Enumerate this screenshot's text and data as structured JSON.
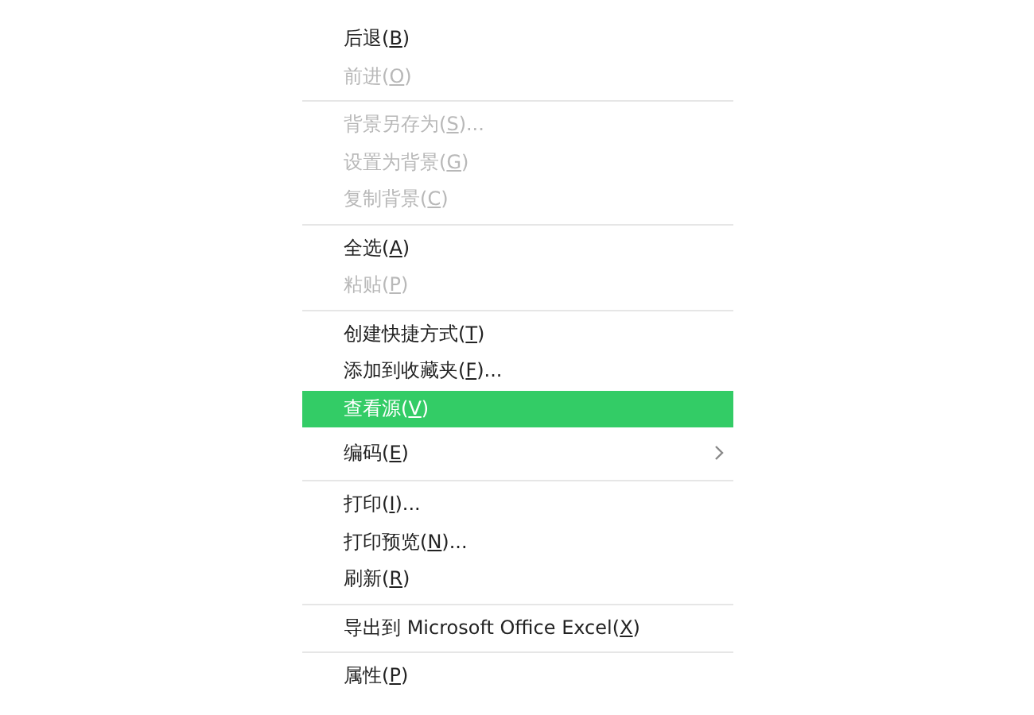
{
  "menu": {
    "groups": [
      {
        "items": [
          {
            "label": "后退(",
            "key": "B",
            "tail": ")",
            "disabled": false,
            "selected": false,
            "submenu": false
          },
          {
            "label": "前进(",
            "key": "O",
            "tail": ")",
            "disabled": true,
            "selected": false,
            "submenu": false
          }
        ]
      },
      {
        "items": [
          {
            "label": "背景另存为(",
            "key": "S",
            "tail": ")...",
            "disabled": true,
            "selected": false,
            "submenu": false
          },
          {
            "label": "设置为背景(",
            "key": "G",
            "tail": ")",
            "disabled": true,
            "selected": false,
            "submenu": false
          },
          {
            "label": "复制背景(",
            "key": "C",
            "tail": ")",
            "disabled": true,
            "selected": false,
            "submenu": false
          }
        ]
      },
      {
        "items": [
          {
            "label": "全选(",
            "key": "A",
            "tail": ")",
            "disabled": false,
            "selected": false,
            "submenu": false
          },
          {
            "label": "粘贴(",
            "key": "P",
            "tail": ")",
            "disabled": true,
            "selected": false,
            "submenu": false
          }
        ]
      },
      {
        "items": [
          {
            "label": "创建快捷方式(",
            "key": "T",
            "tail": ")",
            "disabled": false,
            "selected": false,
            "submenu": false
          },
          {
            "label": "添加到收藏夹(",
            "key": "F",
            "tail": ")...",
            "disabled": false,
            "selected": false,
            "submenu": false
          },
          {
            "label": "查看源(",
            "key": "V",
            "tail": ")",
            "disabled": false,
            "selected": true,
            "submenu": false
          },
          {
            "label": "编码(",
            "key": "E",
            "tail": ")",
            "disabled": false,
            "selected": false,
            "submenu": true
          }
        ]
      },
      {
        "items": [
          {
            "label": "打印(",
            "key": "I",
            "tail": ")...",
            "disabled": false,
            "selected": false,
            "submenu": false
          },
          {
            "label": "打印预览(",
            "key": "N",
            "tail": ")...",
            "disabled": false,
            "selected": false,
            "submenu": false
          },
          {
            "label": "刷新(",
            "key": "R",
            "tail": ")",
            "disabled": false,
            "selected": false,
            "submenu": false
          }
        ]
      },
      {
        "items": [
          {
            "label": "导出到 Microsoft Office Excel(",
            "key": "X",
            "tail": ")",
            "disabled": false,
            "selected": false,
            "submenu": false
          }
        ]
      },
      {
        "items": [
          {
            "label": "属性(",
            "key": "P",
            "tail": ")",
            "disabled": false,
            "selected": false,
            "submenu": false
          }
        ]
      }
    ]
  }
}
